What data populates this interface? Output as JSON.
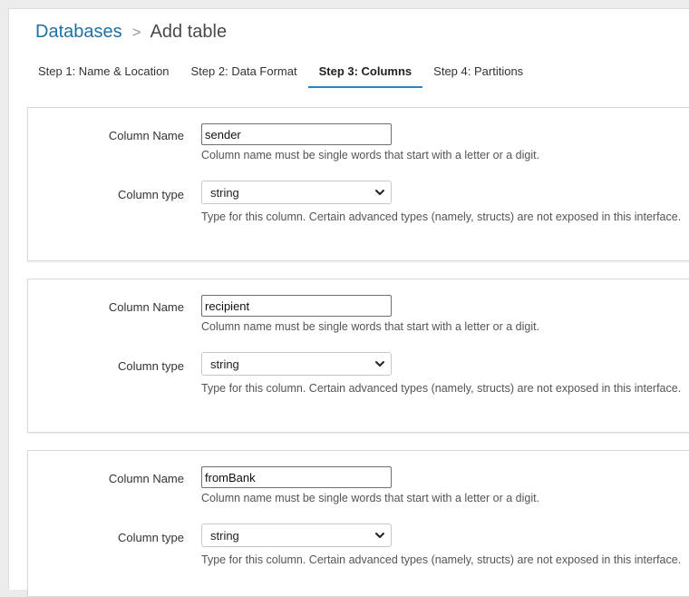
{
  "breadcrumb": {
    "parent": "Databases",
    "separator": ">",
    "current": "Add table"
  },
  "tabs": [
    {
      "label": "Step 1: Name & Location",
      "active": false
    },
    {
      "label": "Step 2: Data Format",
      "active": false
    },
    {
      "label": "Step 3: Columns",
      "active": true
    },
    {
      "label": "Step 4: Partitions",
      "active": false
    }
  ],
  "columns": [
    {
      "name_label": "Column Name",
      "name_value": "sender",
      "name_help": "Column name must be single words that start with a letter or a digit.",
      "type_label": "Column type",
      "type_value": "string",
      "type_help": "Type for this column. Certain advanced types (namely, structs) are not exposed in this interface."
    },
    {
      "name_label": "Column Name",
      "name_value": "recipient",
      "name_help": "Column name must be single words that start with a letter or a digit.",
      "type_label": "Column type",
      "type_value": "string",
      "type_help": "Type for this column. Certain advanced types (namely, structs) are not exposed in this interface."
    },
    {
      "name_label": "Column Name",
      "name_value": "fromBank",
      "name_help": "Column name must be single words that start with a letter or a digit.",
      "type_label": "Column type",
      "type_value": "string",
      "type_help": "Type for this column. Certain advanced types (namely, structs) are not exposed in this interface."
    }
  ],
  "icons": {
    "select_arrow": "chevron-down-icon"
  },
  "colors": {
    "link": "#1f70a3",
    "active_tab_underline": "#2a85c7",
    "background": "#ececec"
  }
}
